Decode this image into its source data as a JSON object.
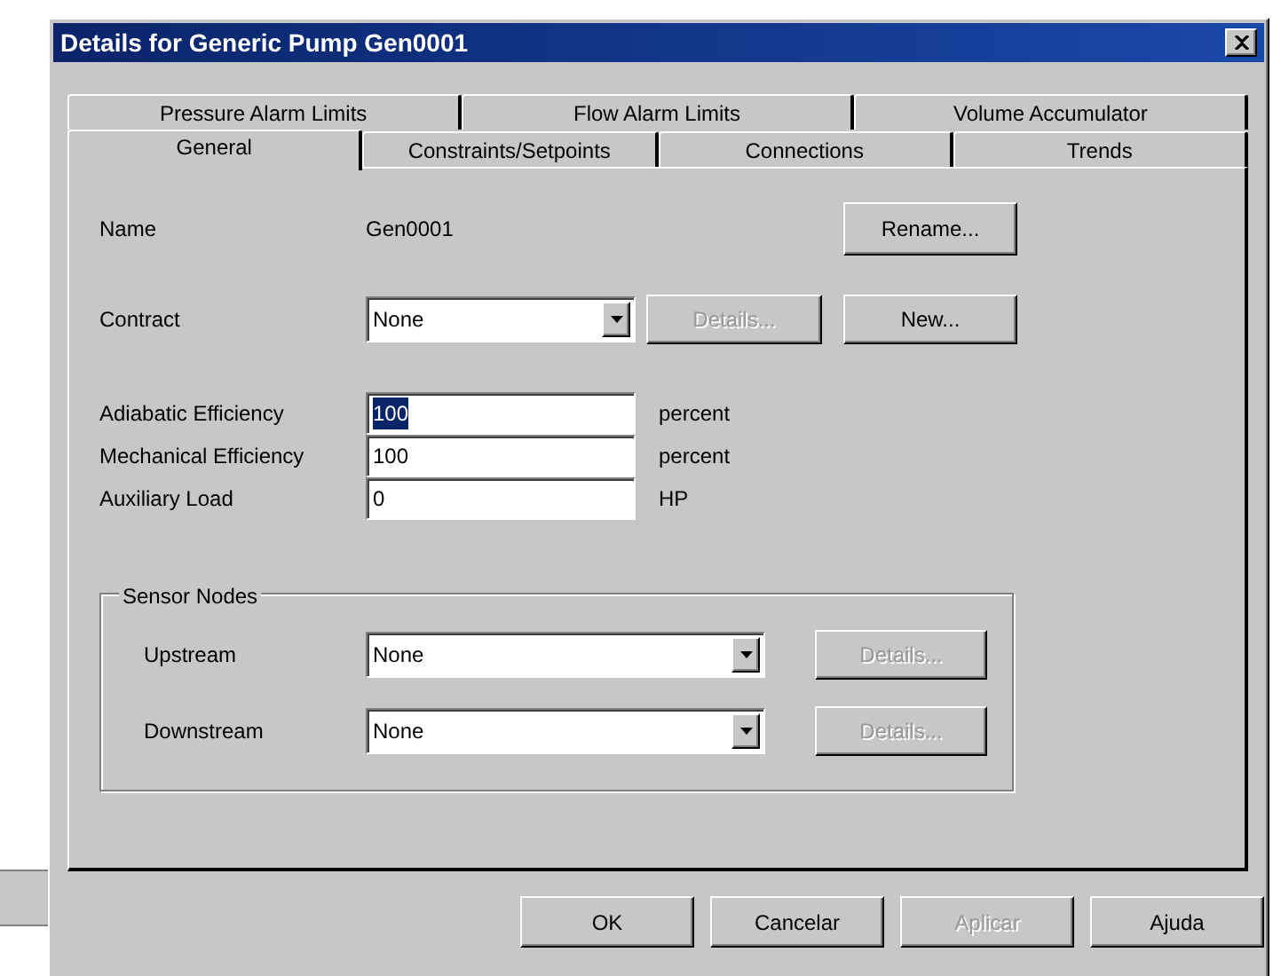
{
  "window": {
    "title": "Details for Generic Pump Gen0001"
  },
  "tab_rows": [
    [
      {
        "label": "Pressure Alarm Limits",
        "selected": false
      },
      {
        "label": "Flow Alarm Limits",
        "selected": false
      },
      {
        "label": "Volume Accumulator",
        "selected": false
      }
    ],
    [
      {
        "label": "General",
        "selected": true
      },
      {
        "label": "Constraints/Setpoints",
        "selected": false
      },
      {
        "label": "Connections",
        "selected": false
      },
      {
        "label": "Trends",
        "selected": false
      }
    ]
  ],
  "name": {
    "label": "Name",
    "value": "Gen0001",
    "button": {
      "label": "Rename...",
      "disabled": false
    }
  },
  "contract": {
    "label": "Contract",
    "value": "None",
    "buttons": [
      {
        "label": "Details...",
        "disabled": true
      },
      {
        "label": "New...",
        "disabled": false
      }
    ]
  },
  "efficiency_fields": [
    {
      "label": "Adiabatic Efficiency",
      "value": "100",
      "unit": "percent",
      "text_selected": true
    },
    {
      "label": "Mechanical Efficiency",
      "value": "100",
      "unit": "percent",
      "text_selected": false
    },
    {
      "label": "Auxiliary Load",
      "value": "0",
      "unit": "HP",
      "text_selected": false
    }
  ],
  "sensor_nodes": {
    "title": "Sensor Nodes",
    "rows": [
      {
        "label": "Upstream",
        "value": "None",
        "button": {
          "label": "Details...",
          "disabled": true
        }
      },
      {
        "label": "Downstream",
        "value": "None",
        "button": {
          "label": "Details...",
          "disabled": true
        }
      }
    ]
  },
  "buttons": [
    {
      "label": "OK",
      "disabled": false
    },
    {
      "label": "Cancelar",
      "disabled": false
    },
    {
      "label": "Aplicar",
      "disabled": true
    },
    {
      "label": "Ajuda",
      "disabled": false
    }
  ]
}
